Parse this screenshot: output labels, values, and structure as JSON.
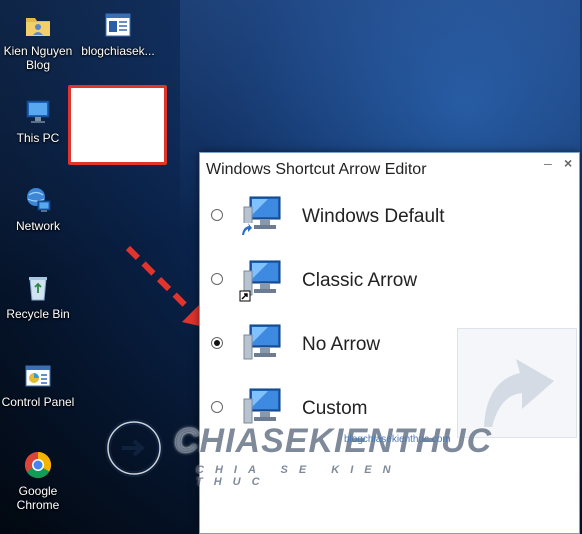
{
  "desktop": {
    "icons": [
      {
        "label": "Kien Nguyen Blog"
      },
      {
        "label": "blogchiasek..."
      },
      {
        "label": "This PC"
      },
      {
        "label": "Network"
      },
      {
        "label": "Recycle Bin"
      },
      {
        "label": "Control Panel"
      },
      {
        "label": "Google Chrome"
      }
    ]
  },
  "dialog": {
    "title": "Windows Shortcut Arrow Editor",
    "minimize_glyph": "–",
    "close_glyph": "×",
    "options": [
      {
        "label": "Windows Default",
        "selected": false
      },
      {
        "label": "Classic Arrow",
        "selected": false
      },
      {
        "label": "No Arrow",
        "selected": true
      },
      {
        "label": "Custom",
        "selected": false
      }
    ]
  },
  "watermark": {
    "brand": "CHIASEKIENTHUC",
    "tagline": "CHIA SE KIEN THUC",
    "url": "blogchiasekienthuc.com"
  },
  "colors": {
    "highlight_border": "#e0342d",
    "annotation_arrow": "#e0342d"
  }
}
